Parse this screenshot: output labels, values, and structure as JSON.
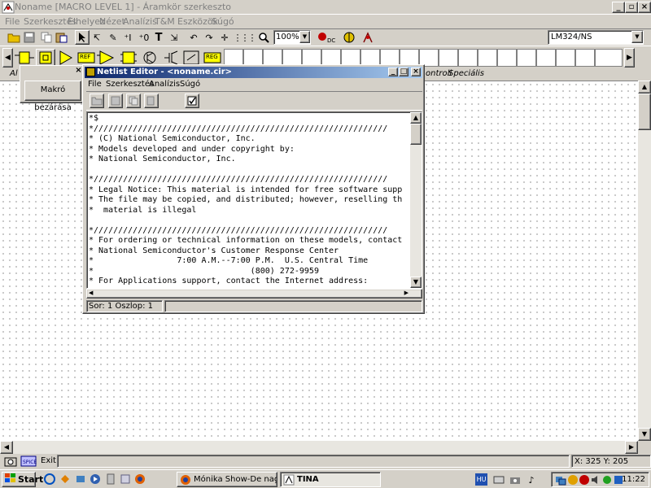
{
  "window": {
    "title": "Noname [MACRO LEVEL 1] - Áramkör szerkeszto"
  },
  "menu": [
    "File",
    "Szerkesztés",
    "Elhelyez",
    "Nézet",
    "Analízis",
    "T&M",
    "Eszközök",
    "Súgó"
  ],
  "toolbar": {
    "zoom": "100%",
    "component_select": "LM324/NS",
    "component_labels": [
      "REF",
      "REG"
    ]
  },
  "tabs": {
    "left_fragment": "Al",
    "right": [
      "ontroll",
      "Speciális"
    ]
  },
  "macro_dialog": {
    "button": "Makró bezárása",
    "close": "×"
  },
  "netlist_editor": {
    "title": "Netlist Editor - <noname.cir>",
    "menu": [
      "File",
      "Szerkesztés",
      "Analízis",
      "Súgó"
    ],
    "lines": [
      "*$",
      "*////////////////////////////////////////////////////////////",
      "* (C) National Semiconductor, Inc.",
      "* Models developed and under copyright by:",
      "* National Semiconductor, Inc.",
      "",
      "*////////////////////////////////////////////////////////////",
      "* Legal Notice: This material is intended for free software supp",
      "* The file may be copied, and distributed; however, reselling th",
      "*  material is illegal",
      "",
      "*////////////////////////////////////////////////////////////",
      "* For ordering or technical information on these models, contact",
      "* National Semiconductor's Customer Response Center",
      "*                 7:00 A.M.--7:00 P.M.  U.S. Central Time",
      "*                                (800) 272-9959",
      "* For Applications support, contact the Internet address:"
    ],
    "status": "Sor: 1 Oszlop: 1"
  },
  "statusbar": {
    "exit": "Exit",
    "coords": "X: 325  Y: 205"
  },
  "taskbar": {
    "start": "Start",
    "tasks": [
      "Mónika Show-De nagy ja...",
      "TINA"
    ],
    "lang": "HU",
    "clock": "11:22"
  }
}
